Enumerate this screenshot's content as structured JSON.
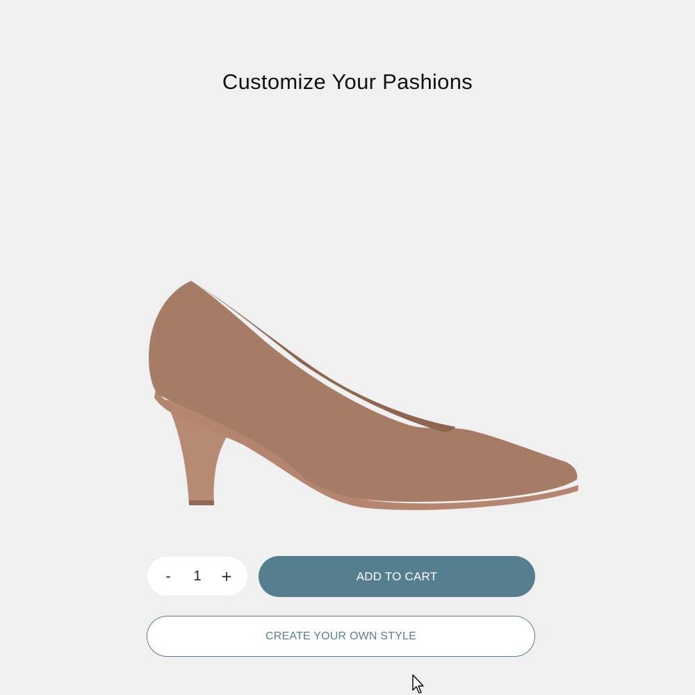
{
  "header": {
    "title": "Customize Your Pashions"
  },
  "product": {
    "image_icon": "high-heel-pump-shoe",
    "color": "#a67c66"
  },
  "cart": {
    "decrement_label": "-",
    "quantity": "1",
    "increment_label": "+",
    "add_to_cart_label": "ADD TO CART",
    "create_style_label": "CREATE YOUR OWN STYLE"
  },
  "colors": {
    "accent": "#557f8e",
    "background": "#f0f0f0"
  }
}
